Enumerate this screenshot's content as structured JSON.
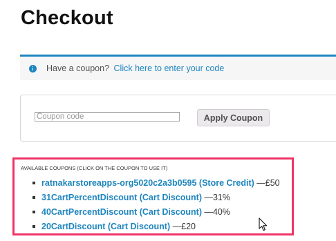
{
  "page": {
    "title": "Checkout"
  },
  "coupon_notice": {
    "icon": "info-icon",
    "text": "Have a coupon?",
    "link": "Click here to enter your code",
    "accent_color": "#1e85be"
  },
  "coupon_form": {
    "input_placeholder": "Coupon code",
    "input_value": "",
    "apply_label": "Apply Coupon"
  },
  "available_coupons": {
    "heading": "Available Coupons (click on the coupon to use it)",
    "highlight_color": "#ee3467",
    "items": [
      {
        "name": "ratnakarstoreapps-org5020c2a3b0595 (Store Credit)",
        "amount": "—£50"
      },
      {
        "name": "31CartPercentDiscount (Cart Discount)",
        "amount": "—31%"
      },
      {
        "name": "40CartPercentDiscount (Cart Discount)",
        "amount": "—40%"
      },
      {
        "name": "20CartDiscount (Cart Discount)",
        "amount": "—£20"
      }
    ]
  },
  "cursor": {
    "icon": "mouse-pointer-icon"
  }
}
